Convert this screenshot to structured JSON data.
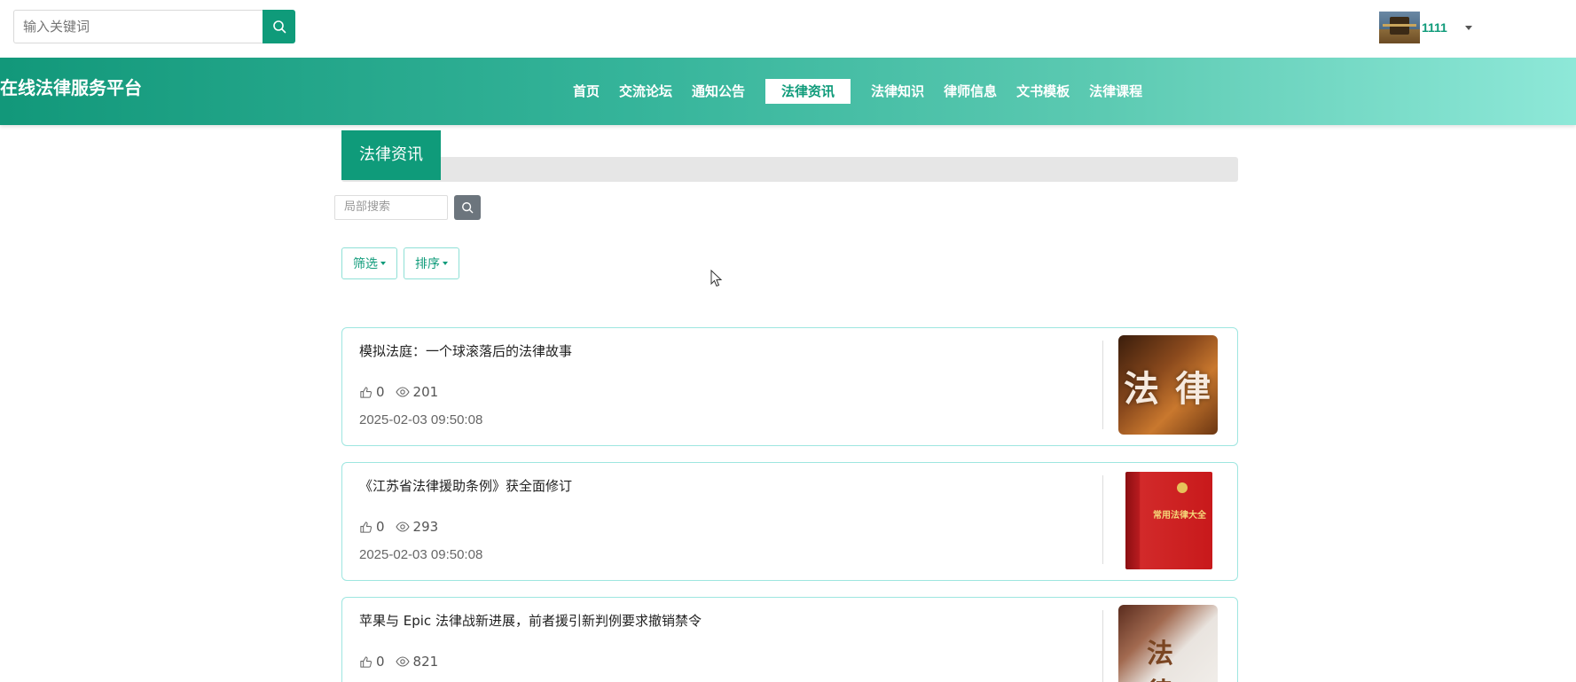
{
  "header": {
    "search_placeholder": "输入关键词",
    "user_name": "1111"
  },
  "brand": "在线法律服务平台",
  "nav": [
    {
      "label": "首页"
    },
    {
      "label": "交流论坛"
    },
    {
      "label": "通知公告"
    },
    {
      "label": "法律资讯",
      "active": true
    },
    {
      "label": "法律知识"
    },
    {
      "label": "律师信息"
    },
    {
      "label": "文书模板"
    },
    {
      "label": "法律课程"
    }
  ],
  "section": {
    "title": "法律资讯",
    "local_search_placeholder": "局部搜索",
    "filter_label": "筛选",
    "sort_label": "排序"
  },
  "articles": [
    {
      "title": "模拟法庭：一个球滚落后的法律故事",
      "likes": "0",
      "views": "201",
      "date": "2025-02-03 09:50:08",
      "thumb_text": "法 律"
    },
    {
      "title": "《江苏省法律援助条例》获全面修订",
      "likes": "0",
      "views": "293",
      "date": "2025-02-03 09:50:08",
      "thumb_text": "常用法律大全"
    },
    {
      "title": "苹果与 Epic 法律战新进展，前者援引新判例要求撤销禁令",
      "likes": "0",
      "views": "821",
      "thumb_text": "法 律"
    }
  ],
  "colors": {
    "primary": "#0f9b7a",
    "card_border": "#9ee6e0",
    "nav_gradient_end": "#8ee8d8"
  }
}
